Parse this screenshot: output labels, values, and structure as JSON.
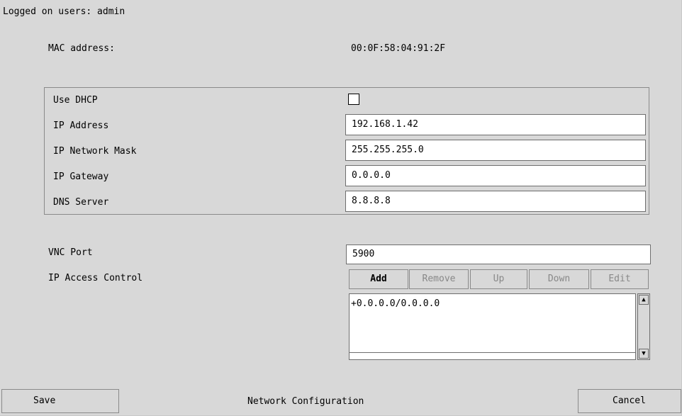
{
  "header": {
    "logged_on": "Logged on users: admin"
  },
  "mac": {
    "label": "MAC address:",
    "value": "00:0F:58:04:91:2F"
  },
  "network": {
    "use_dhcp_label": "Use DHCP",
    "use_dhcp_checked": false,
    "ip_address_label": "IP Address",
    "ip_address_value": "192.168.1.42",
    "netmask_label": "IP Network Mask",
    "netmask_value": "255.255.255.0",
    "gateway_label": "IP Gateway",
    "gateway_value": "0.0.0.0",
    "dns_label": "DNS Server",
    "dns_value": "8.8.8.8"
  },
  "vnc": {
    "port_label": "VNC Port",
    "port_value": "5900"
  },
  "access_control": {
    "label": "IP Access Control",
    "buttons": {
      "add": "Add",
      "remove": "Remove",
      "up": "Up",
      "down": "Down",
      "edit": "Edit"
    },
    "entries": [
      "+0.0.0.0/0.0.0.0"
    ]
  },
  "footer": {
    "save": "Save",
    "title": "Network Configuration",
    "cancel": "Cancel"
  },
  "icons": {
    "scroll_up": "up-arrow-icon",
    "scroll_down": "down-arrow-icon"
  }
}
